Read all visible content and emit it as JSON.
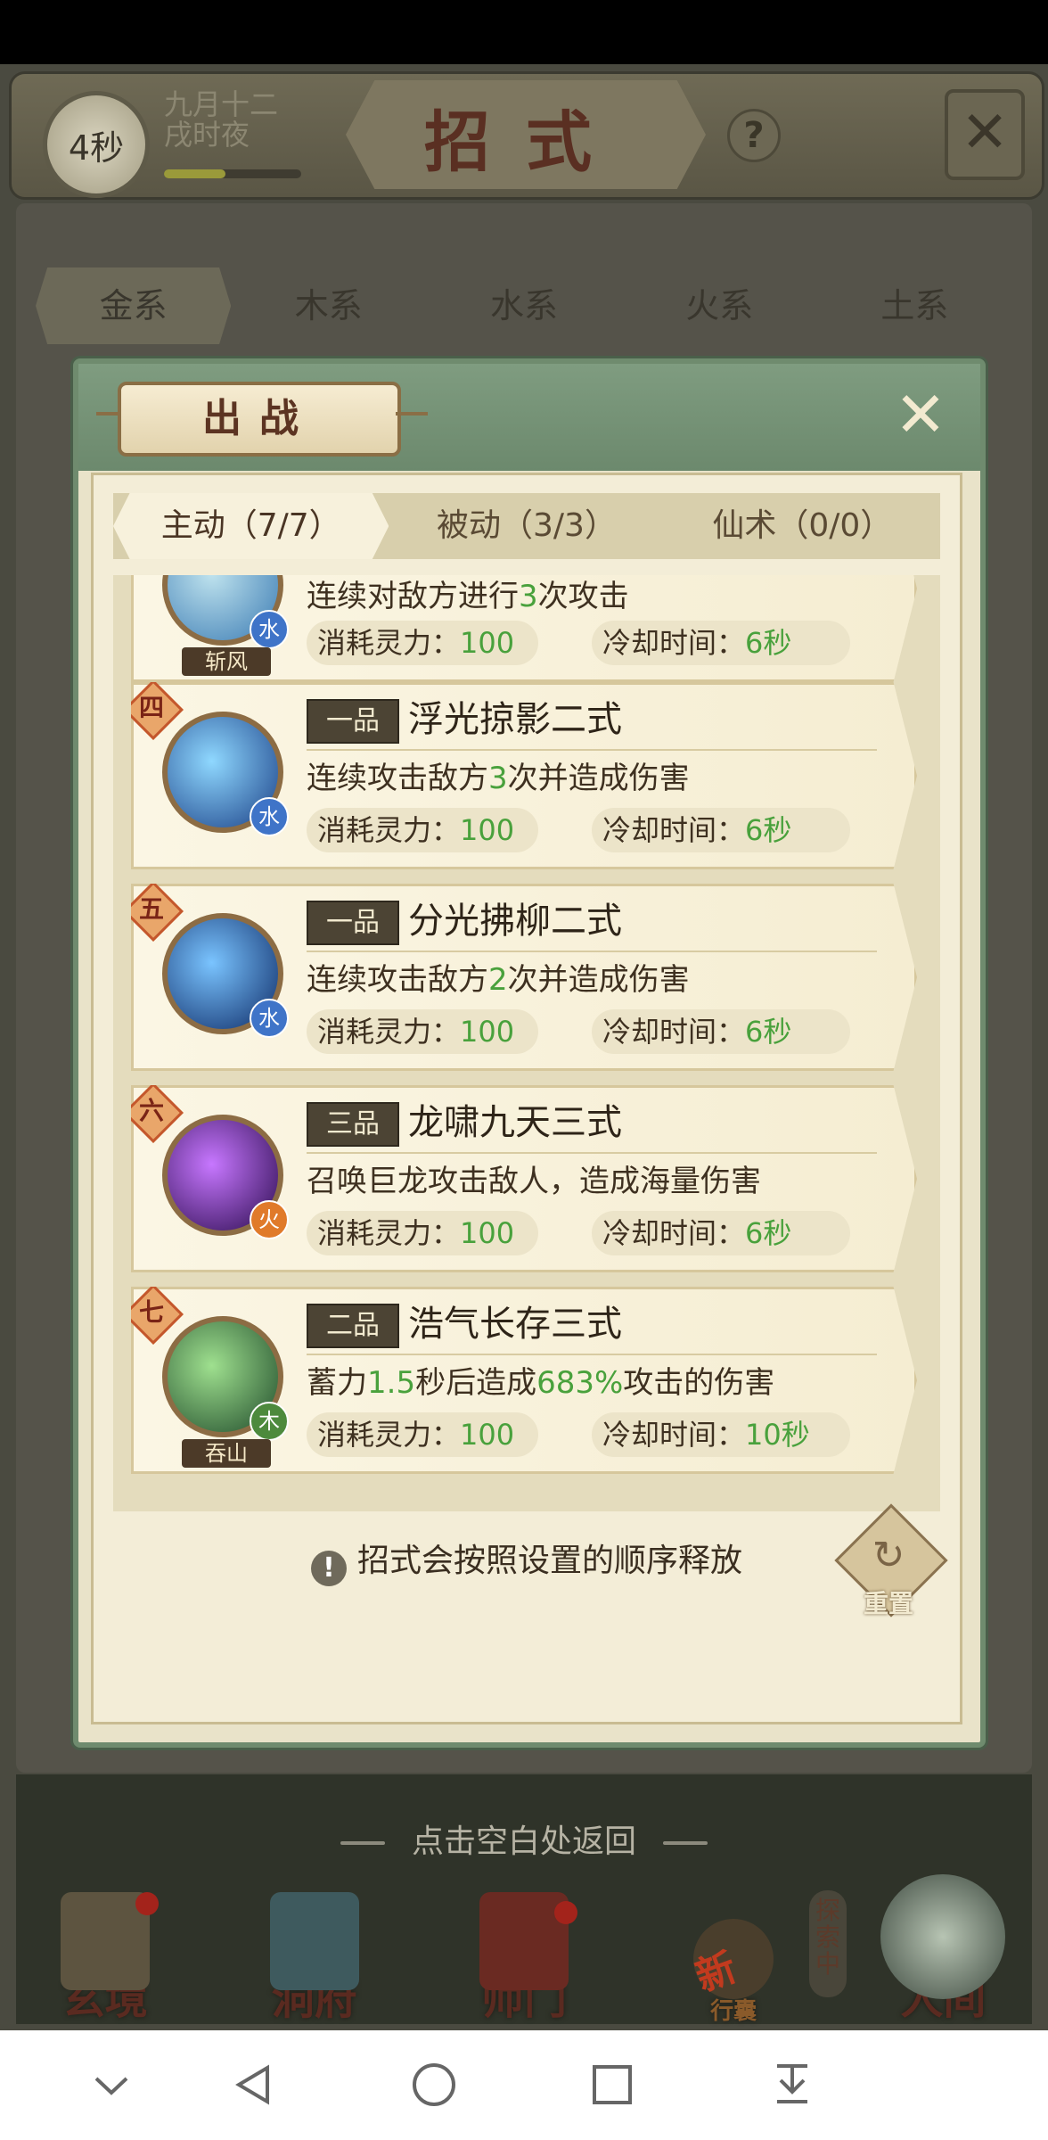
{
  "header": {
    "timer": "4秒",
    "date_line1": "九月十二",
    "date_line2": "戌时夜",
    "title": "招式",
    "time_progress": 0.45
  },
  "element_tabs": [
    "金系",
    "木系",
    "水系",
    "火系",
    "土系"
  ],
  "modal": {
    "title": "出战",
    "subtabs": [
      {
        "label": "主动（7/7）",
        "active": true
      },
      {
        "label": "被动（3/3）",
        "active": false
      },
      {
        "label": "仙术（0/0）",
        "active": false
      }
    ],
    "skills": [
      {
        "rank": "",
        "grade": "",
        "name": "",
        "desc_parts": [
          "连续对敌方进行",
          "3",
          "次攻击"
        ],
        "element": "水",
        "element_color": "#3f74c8",
        "icon_label": "斩风",
        "icon_colors": [
          "#bfe3ee",
          "#3b7bb3"
        ],
        "cost_label": "消耗灵力：",
        "cost_value": "100",
        "cd_label": "冷却时间：",
        "cd_value": "6秒"
      },
      {
        "rank": "四",
        "grade": "一品",
        "name": "浮光掠影二式",
        "desc_parts": [
          "连续攻击敌方",
          "3",
          "次并造成伤害"
        ],
        "element": "水",
        "element_color": "#3f74c8",
        "icon_label": "",
        "icon_colors": [
          "#8fd8ff",
          "#1a3f86"
        ],
        "cost_label": "消耗灵力：",
        "cost_value": "100",
        "cd_label": "冷却时间：",
        "cd_value": "6秒"
      },
      {
        "rank": "五",
        "grade": "一品",
        "name": "分光拂柳二式",
        "desc_parts": [
          "连续攻击敌方",
          "2",
          "次并造成伤害"
        ],
        "element": "水",
        "element_color": "#3f74c8",
        "icon_label": "",
        "icon_colors": [
          "#7ac4ff",
          "#0d2a66"
        ],
        "cost_label": "消耗灵力：",
        "cost_value": "100",
        "cd_label": "冷却时间：",
        "cd_value": "6秒"
      },
      {
        "rank": "六",
        "grade": "三品",
        "name": "龙啸九天三式",
        "desc_parts": [
          "召唤巨龙攻击敌人，造成海量伤害",
          "",
          ""
        ],
        "element": "火",
        "element_color": "#e07a2a",
        "icon_label": "",
        "icon_colors": [
          "#c777ff",
          "#2a0b4d"
        ],
        "cost_label": "消耗灵力：",
        "cost_value": "100",
        "cd_label": "冷却时间：",
        "cd_value": "6秒"
      },
      {
        "rank": "七",
        "grade": "二品",
        "name": "浩气长存三式",
        "desc_parts": [
          "蓄力",
          "1.5",
          "秒后造成",
          "683%",
          "攻击的伤害"
        ],
        "element": "木",
        "element_color": "#4d8a3d",
        "icon_label": "吞山",
        "icon_colors": [
          "#9fe08f",
          "#1f4a2a"
        ],
        "cost_label": "消耗灵力：",
        "cost_value": "100",
        "cd_label": "冷却时间：",
        "cd_value": "10秒"
      }
    ],
    "hint": "招式会按照设置的顺序释放",
    "reset_label": "重置"
  },
  "tap_return": "点击空白处返回",
  "bottom_nav": [
    {
      "label": "玄境",
      "badge": true
    },
    {
      "label": "洞府",
      "badge": false
    },
    {
      "label": "师门",
      "badge": true
    },
    {
      "label": "行囊",
      "badge": false
    },
    {
      "label": "人间",
      "badge": false
    }
  ],
  "explore_badge": "探索中",
  "new_tag": "新",
  "system_nav": [
    "chevron-down",
    "back",
    "home",
    "recents",
    "download"
  ]
}
